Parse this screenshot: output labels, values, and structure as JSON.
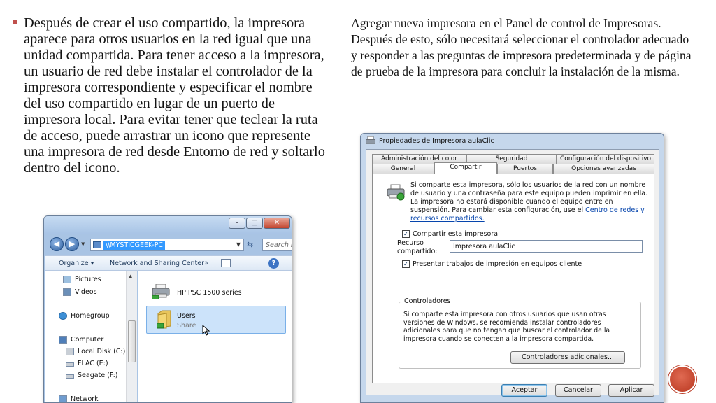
{
  "slide": {
    "left_paragraph": "Después de crear el uso compartido, la impresora aparece para otros usuarios en la red igual que una unidad compartida. Para tener acceso a la impresora, un usuario de red debe instalar el controlador de la impresora correspondiente y especificar el nombre del uso compartido en lugar de un puerto de impresora local. Para evitar tener que teclear la ruta de acceso, puede arrastrar un icono que represente una impresora de red desde Entorno de red y soltarlo dentro del icono.",
    "right_paragraph": " Agregar nueva impresora en el Panel de control de Impresoras. Después de esto, sólo necesitará seleccionar el controlador adecuado y responder a las preguntas de impresora predeterminada y de página de prueba de la impresora para concluir la instalación de la misma.",
    "slide_number": "",
    "accent_color": "#c0504d"
  },
  "explorer": {
    "address": "\\\\MYSTICGEEK-PC",
    "search_placeholder": "Search MYSTIC...",
    "toolbar": {
      "organize": "Organize ▾",
      "network_sharing": "Network and Sharing Center",
      "more": "»"
    },
    "nav": {
      "pictures": "Pictures",
      "videos": "Videos",
      "homegroup": "Homegroup",
      "computer": "Computer",
      "local_disk": "Local Disk (C:)",
      "flac": "FLAC (E:)",
      "seagate": "Seagate (F:)",
      "network": "Network"
    },
    "items": {
      "printer": "HP PSC 1500 series",
      "users_name": "Users",
      "users_sub": "Share"
    }
  },
  "dialog": {
    "title": "Propiedades de Impresora aulaClic",
    "tabs_row1": {
      "color": "Administración del color",
      "security": "Seguridad",
      "device": "Configuración del dispositivo"
    },
    "tabs_row2": {
      "general": "General",
      "share": "Compartir",
      "ports": "Puertos",
      "advanced": "Opciones avanzadas"
    },
    "info_text": "Si comparte esta impresora, sólo los usuarios de la red con un nombre de usuario y una contraseña para este equipo pueden imprimir en ella. La impresora no estará disponible cuando el equipo entre en suspensión. Para cambiar esta configuración, use el ",
    "info_link": "Centro de redes y recursos compartidos.",
    "share_checkbox": "Compartir esta impresora",
    "share_name_label": "Recurso compartido:",
    "share_name_value": "Impresora aulaClic",
    "render_checkbox": "Presentar trabajos de impresión en equipos cliente",
    "drivers_legend": "Controladores",
    "drivers_text": "Si comparte esta impresora con otros usuarios que usan otras versiones de Windows, se recomienda instalar controladores adicionales para que no tengan que buscar el controlador de la impresora cuando se conecten a la impresora compartida.",
    "drivers_button": "Controladores adicionales...",
    "ok": "Aceptar",
    "cancel": "Cancelar",
    "apply": "Aplicar"
  }
}
